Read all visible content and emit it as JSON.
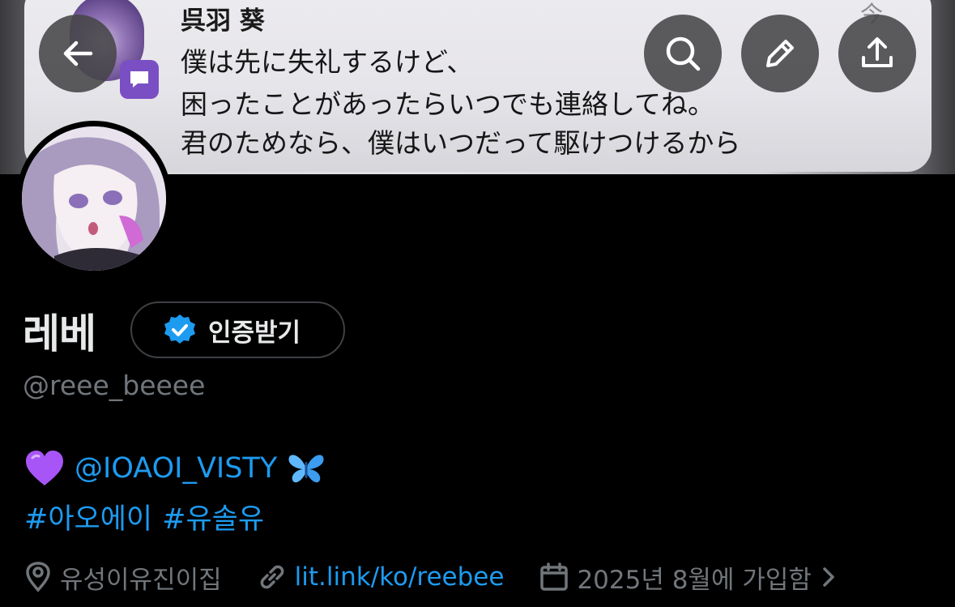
{
  "banner": {
    "chat_sender": "呉羽 葵",
    "chat_time": "今",
    "chat_lines": [
      "僕は先に失礼するけど、",
      "困ったことがあったらいつでも連絡してね。",
      "君のためなら、僕はいつだって駆けつけるから"
    ]
  },
  "header": {
    "back_icon": "arrow-left-icon",
    "search_icon": "search-icon",
    "edit_icon": "pencil-icon",
    "share_icon": "share-icon"
  },
  "profile": {
    "display_name": "레베",
    "verify_label": "인증받기",
    "handle": "@reee_beeee",
    "bio": {
      "mention": "@IOAOI_VISTY",
      "hashtag1": "#아오에이",
      "hashtag2": "#유솔유"
    },
    "location": "유성이유진이집",
    "website": "lit.link/ko/reebee",
    "joined": "2025년 8월에 가입함"
  },
  "colors": {
    "accent": "#1d9bf0",
    "muted": "#71767b",
    "text": "#e7e9ea",
    "background": "#000000"
  }
}
